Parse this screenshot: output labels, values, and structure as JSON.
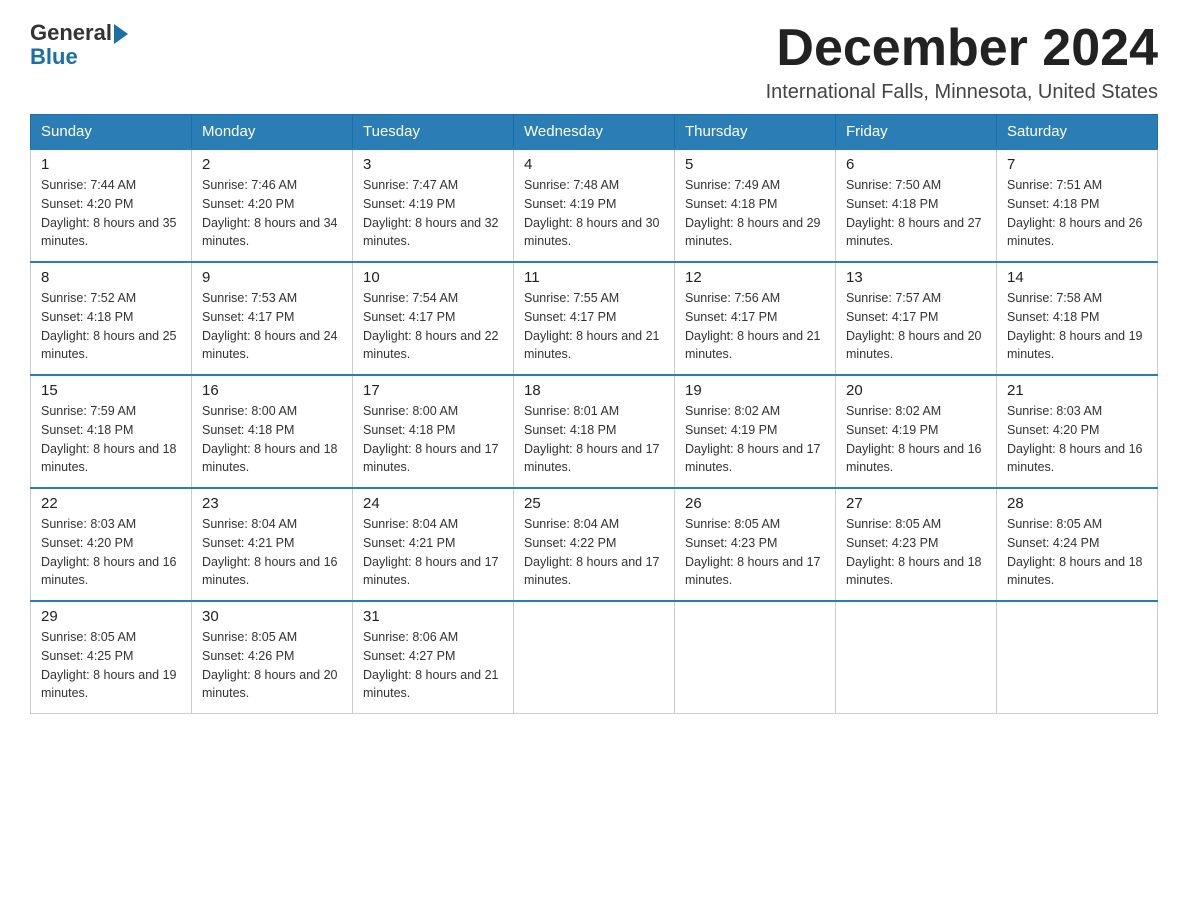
{
  "logo": {
    "general": "General",
    "blue": "Blue"
  },
  "title": "December 2024",
  "location": "International Falls, Minnesota, United States",
  "weekdays": [
    "Sunday",
    "Monday",
    "Tuesday",
    "Wednesday",
    "Thursday",
    "Friday",
    "Saturday"
  ],
  "weeks": [
    [
      {
        "day": "1",
        "sunrise": "7:44 AM",
        "sunset": "4:20 PM",
        "daylight": "8 hours and 35 minutes."
      },
      {
        "day": "2",
        "sunrise": "7:46 AM",
        "sunset": "4:20 PM",
        "daylight": "8 hours and 34 minutes."
      },
      {
        "day": "3",
        "sunrise": "7:47 AM",
        "sunset": "4:19 PM",
        "daylight": "8 hours and 32 minutes."
      },
      {
        "day": "4",
        "sunrise": "7:48 AM",
        "sunset": "4:19 PM",
        "daylight": "8 hours and 30 minutes."
      },
      {
        "day": "5",
        "sunrise": "7:49 AM",
        "sunset": "4:18 PM",
        "daylight": "8 hours and 29 minutes."
      },
      {
        "day": "6",
        "sunrise": "7:50 AM",
        "sunset": "4:18 PM",
        "daylight": "8 hours and 27 minutes."
      },
      {
        "day": "7",
        "sunrise": "7:51 AM",
        "sunset": "4:18 PM",
        "daylight": "8 hours and 26 minutes."
      }
    ],
    [
      {
        "day": "8",
        "sunrise": "7:52 AM",
        "sunset": "4:18 PM",
        "daylight": "8 hours and 25 minutes."
      },
      {
        "day": "9",
        "sunrise": "7:53 AM",
        "sunset": "4:17 PM",
        "daylight": "8 hours and 24 minutes."
      },
      {
        "day": "10",
        "sunrise": "7:54 AM",
        "sunset": "4:17 PM",
        "daylight": "8 hours and 22 minutes."
      },
      {
        "day": "11",
        "sunrise": "7:55 AM",
        "sunset": "4:17 PM",
        "daylight": "8 hours and 21 minutes."
      },
      {
        "day": "12",
        "sunrise": "7:56 AM",
        "sunset": "4:17 PM",
        "daylight": "8 hours and 21 minutes."
      },
      {
        "day": "13",
        "sunrise": "7:57 AM",
        "sunset": "4:17 PM",
        "daylight": "8 hours and 20 minutes."
      },
      {
        "day": "14",
        "sunrise": "7:58 AM",
        "sunset": "4:18 PM",
        "daylight": "8 hours and 19 minutes."
      }
    ],
    [
      {
        "day": "15",
        "sunrise": "7:59 AM",
        "sunset": "4:18 PM",
        "daylight": "8 hours and 18 minutes."
      },
      {
        "day": "16",
        "sunrise": "8:00 AM",
        "sunset": "4:18 PM",
        "daylight": "8 hours and 18 minutes."
      },
      {
        "day": "17",
        "sunrise": "8:00 AM",
        "sunset": "4:18 PM",
        "daylight": "8 hours and 17 minutes."
      },
      {
        "day": "18",
        "sunrise": "8:01 AM",
        "sunset": "4:18 PM",
        "daylight": "8 hours and 17 minutes."
      },
      {
        "day": "19",
        "sunrise": "8:02 AM",
        "sunset": "4:19 PM",
        "daylight": "8 hours and 17 minutes."
      },
      {
        "day": "20",
        "sunrise": "8:02 AM",
        "sunset": "4:19 PM",
        "daylight": "8 hours and 16 minutes."
      },
      {
        "day": "21",
        "sunrise": "8:03 AM",
        "sunset": "4:20 PM",
        "daylight": "8 hours and 16 minutes."
      }
    ],
    [
      {
        "day": "22",
        "sunrise": "8:03 AM",
        "sunset": "4:20 PM",
        "daylight": "8 hours and 16 minutes."
      },
      {
        "day": "23",
        "sunrise": "8:04 AM",
        "sunset": "4:21 PM",
        "daylight": "8 hours and 16 minutes."
      },
      {
        "day": "24",
        "sunrise": "8:04 AM",
        "sunset": "4:21 PM",
        "daylight": "8 hours and 17 minutes."
      },
      {
        "day": "25",
        "sunrise": "8:04 AM",
        "sunset": "4:22 PM",
        "daylight": "8 hours and 17 minutes."
      },
      {
        "day": "26",
        "sunrise": "8:05 AM",
        "sunset": "4:23 PM",
        "daylight": "8 hours and 17 minutes."
      },
      {
        "day": "27",
        "sunrise": "8:05 AM",
        "sunset": "4:23 PM",
        "daylight": "8 hours and 18 minutes."
      },
      {
        "day": "28",
        "sunrise": "8:05 AM",
        "sunset": "4:24 PM",
        "daylight": "8 hours and 18 minutes."
      }
    ],
    [
      {
        "day": "29",
        "sunrise": "8:05 AM",
        "sunset": "4:25 PM",
        "daylight": "8 hours and 19 minutes."
      },
      {
        "day": "30",
        "sunrise": "8:05 AM",
        "sunset": "4:26 PM",
        "daylight": "8 hours and 20 minutes."
      },
      {
        "day": "31",
        "sunrise": "8:06 AM",
        "sunset": "4:27 PM",
        "daylight": "8 hours and 21 minutes."
      },
      null,
      null,
      null,
      null
    ]
  ]
}
